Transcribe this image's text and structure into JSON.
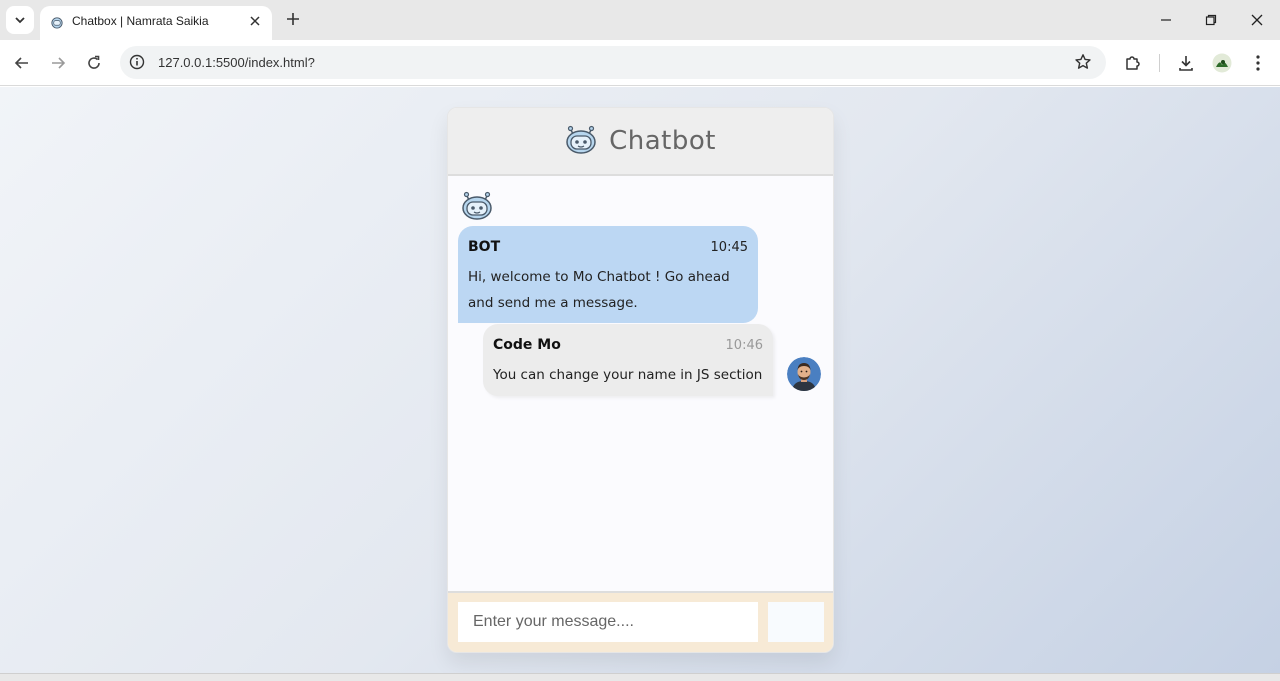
{
  "browser": {
    "tab_title": "Chatbox | Namrata Saikia",
    "url": "127.0.0.1:5500/index.html?"
  },
  "chat": {
    "title": "Chatbot",
    "messages": [
      {
        "sender": "BOT",
        "time": "10:45",
        "text": "Hi, welcome to Mo Chatbot ! Go ahead and send me a message."
      },
      {
        "sender": "Code Mo",
        "time": "10:46",
        "text": "You can change your name in JS section"
      }
    ],
    "input_placeholder": "Enter your message....",
    "send_label": ""
  },
  "colors": {
    "bot_bubble": "#bcd7f3",
    "user_bubble": "#ececec",
    "input_bar": "#f7ead6",
    "header": "#eeeeee"
  },
  "icons": {
    "tab_search": "chevron-down-icon",
    "favicon": "robot-icon",
    "bot_avatar": "robot-icon",
    "user_avatar": "person-avatar"
  }
}
